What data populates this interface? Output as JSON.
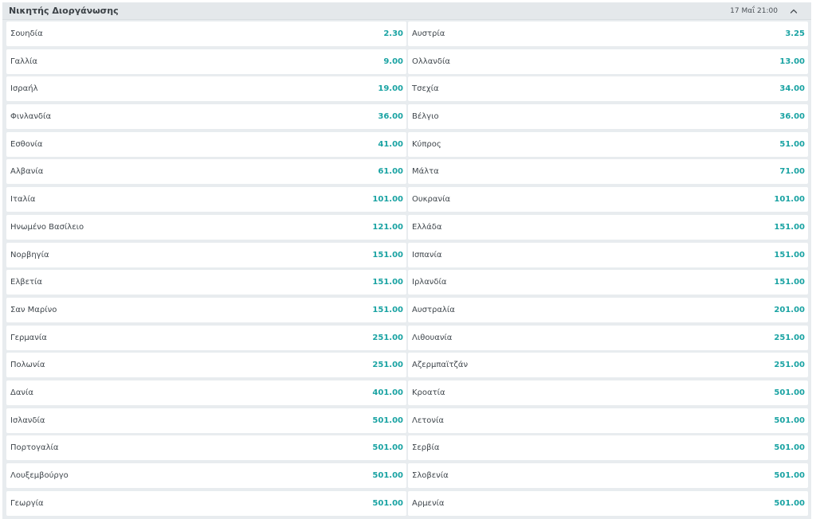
{
  "market": {
    "title": "Νικητής Διοργάνωσης",
    "datetime": "17 Μαΐ 21:00",
    "collapse_icon": "chevron-up-icon",
    "colors": {
      "odds": "#1aa3a3",
      "header_bg": "#e4e8eb",
      "cell_bg": "#ffffff"
    }
  },
  "rows": [
    {
      "left": {
        "name": "Σουηδία",
        "odds": "2.30"
      },
      "right": {
        "name": "Αυστρία",
        "odds": "3.25"
      }
    },
    {
      "left": {
        "name": "Γαλλία",
        "odds": "9.00"
      },
      "right": {
        "name": "Ολλανδία",
        "odds": "13.00"
      }
    },
    {
      "left": {
        "name": "Ισραήλ",
        "odds": "19.00"
      },
      "right": {
        "name": "Τσεχία",
        "odds": "34.00"
      }
    },
    {
      "left": {
        "name": "Φινλανδία",
        "odds": "36.00"
      },
      "right": {
        "name": "Βέλγιο",
        "odds": "36.00"
      }
    },
    {
      "left": {
        "name": "Εσθονία",
        "odds": "41.00"
      },
      "right": {
        "name": "Κύπρος",
        "odds": "51.00"
      }
    },
    {
      "left": {
        "name": "Αλβανία",
        "odds": "61.00"
      },
      "right": {
        "name": "Μάλτα",
        "odds": "71.00"
      }
    },
    {
      "left": {
        "name": "Ιταλία",
        "odds": "101.00"
      },
      "right": {
        "name": "Ουκρανία",
        "odds": "101.00"
      }
    },
    {
      "left": {
        "name": "Ηνωμένο Βασίλειο",
        "odds": "121.00"
      },
      "right": {
        "name": "Ελλάδα",
        "odds": "151.00"
      }
    },
    {
      "left": {
        "name": "Νορβηγία",
        "odds": "151.00"
      },
      "right": {
        "name": "Ισπανία",
        "odds": "151.00"
      }
    },
    {
      "left": {
        "name": "Ελβετία",
        "odds": "151.00"
      },
      "right": {
        "name": "Ιρλανδία",
        "odds": "151.00"
      }
    },
    {
      "left": {
        "name": "Σαν Μαρίνο",
        "odds": "151.00"
      },
      "right": {
        "name": "Αυστραλία",
        "odds": "201.00"
      }
    },
    {
      "left": {
        "name": "Γερμανία",
        "odds": "251.00"
      },
      "right": {
        "name": "Λιθουανία",
        "odds": "251.00"
      }
    },
    {
      "left": {
        "name": "Πολωνία",
        "odds": "251.00"
      },
      "right": {
        "name": "Αζερμπαϊτζάν",
        "odds": "251.00"
      }
    },
    {
      "left": {
        "name": "Δανία",
        "odds": "401.00"
      },
      "right": {
        "name": "Κροατία",
        "odds": "501.00"
      }
    },
    {
      "left": {
        "name": "Ισλανδία",
        "odds": "501.00"
      },
      "right": {
        "name": "Λετονία",
        "odds": "501.00"
      }
    },
    {
      "left": {
        "name": "Πορτογαλία",
        "odds": "501.00"
      },
      "right": {
        "name": "Σερβία",
        "odds": "501.00"
      }
    },
    {
      "left": {
        "name": "Λουξεμβούργο",
        "odds": "501.00"
      },
      "right": {
        "name": "Σλοβενία",
        "odds": "501.00"
      }
    },
    {
      "left": {
        "name": "Γεωργία",
        "odds": "501.00"
      },
      "right": {
        "name": "Αρμενία",
        "odds": "501.00"
      }
    }
  ]
}
